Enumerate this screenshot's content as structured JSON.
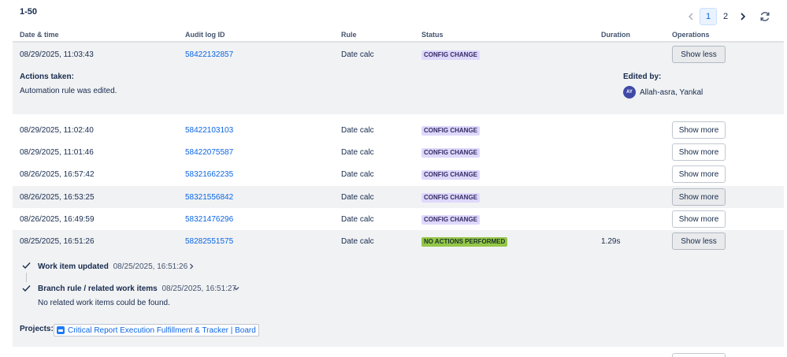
{
  "results_count": "1-50",
  "pagination": {
    "pages": [
      "1",
      "2"
    ],
    "current": "1",
    "prev_icon": "chevron-left-icon",
    "next_icon": "chevron-right-icon",
    "refresh_icon": "refresh-icon"
  },
  "columns": {
    "date": "Date & time",
    "id": "Audit log ID",
    "rule": "Rule",
    "status": "Status",
    "duration": "Duration",
    "ops": "Operations"
  },
  "rows": [
    {
      "date": "08/29/2025, 11:03:43",
      "id": "58422132857",
      "rule": "Date calc",
      "status": "CONFIG CHANGE",
      "duration": "",
      "op": "Show less"
    },
    {
      "date": "08/29/2025, 11:02:40",
      "id": "58422103103",
      "rule": "Date calc",
      "status": "CONFIG CHANGE",
      "duration": "",
      "op": "Show more"
    },
    {
      "date": "08/29/2025, 11:01:46",
      "id": "58422075587",
      "rule": "Date calc",
      "status": "CONFIG CHANGE",
      "duration": "",
      "op": "Show more"
    },
    {
      "date": "08/26/2025, 16:57:42",
      "id": "58321662235",
      "rule": "Date calc",
      "status": "CONFIG CHANGE",
      "duration": "",
      "op": "Show more"
    },
    {
      "date": "08/26/2025, 16:53:25",
      "id": "58321556842",
      "rule": "Date calc",
      "status": "CONFIG CHANGE",
      "duration": "",
      "op": "Show more"
    },
    {
      "date": "08/26/2025, 16:49:59",
      "id": "58321476296",
      "rule": "Date calc",
      "status": "CONFIG CHANGE",
      "duration": "",
      "op": "Show more"
    },
    {
      "date": "08/25/2025, 16:51:26",
      "id": "58282551575",
      "rule": "Date calc",
      "status": "NO ACTIONS PERFORMED",
      "duration": "1.29s",
      "op": "Show less"
    }
  ],
  "detail1": {
    "actions_label": "Actions taken:",
    "actions_text": "Automation rule was edited.",
    "edited_by_label": "Edited by:",
    "avatar_initials": "AY",
    "editor_name": "Allah-asra, Yankal"
  },
  "detail2": {
    "step1_title": "Work item updated",
    "step1_time": "08/25/2025, 16:51:26",
    "step2_title": "Branch rule / related work items",
    "step2_time": "08/25/2025, 16:51:27",
    "step2_note": "No related work items could be found.",
    "projects_label": "Projects:",
    "project_name": "Critical Report Execution Fulfillment & Tracker | Board"
  }
}
